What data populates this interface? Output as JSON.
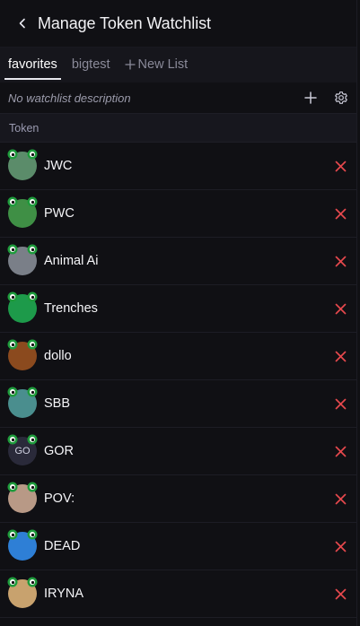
{
  "header": {
    "title": "Manage Token Watchlist"
  },
  "tabs": [
    {
      "label": "favorites",
      "active": true
    },
    {
      "label": "bigtest",
      "active": false
    }
  ],
  "new_list_label": "New List",
  "description": "No watchlist description",
  "column_header": "Token",
  "tokens": [
    {
      "name": "JWC",
      "avatar_color": "#5b8c6a"
    },
    {
      "name": "PWC",
      "avatar_color": "#3f8f45"
    },
    {
      "name": "Animal Ai",
      "avatar_color": "#7a7f88"
    },
    {
      "name": "Trenches",
      "avatar_color": "#1d9a4a"
    },
    {
      "name": "dollo",
      "avatar_color": "#8b4a1e"
    },
    {
      "name": "SBB",
      "avatar_color": "#4a8e8e"
    },
    {
      "name": "GOR",
      "avatar_color": "#2a2a3a",
      "avatar_text": "GO"
    },
    {
      "name": "POV:",
      "avatar_color": "#b89986"
    },
    {
      "name": "DEAD",
      "avatar_color": "#2e7fd6"
    },
    {
      "name": "IRYNA",
      "avatar_color": "#c8a26e"
    }
  ],
  "colors": {
    "remove": "#e5484d",
    "frog_green": "#1f9b3c"
  }
}
